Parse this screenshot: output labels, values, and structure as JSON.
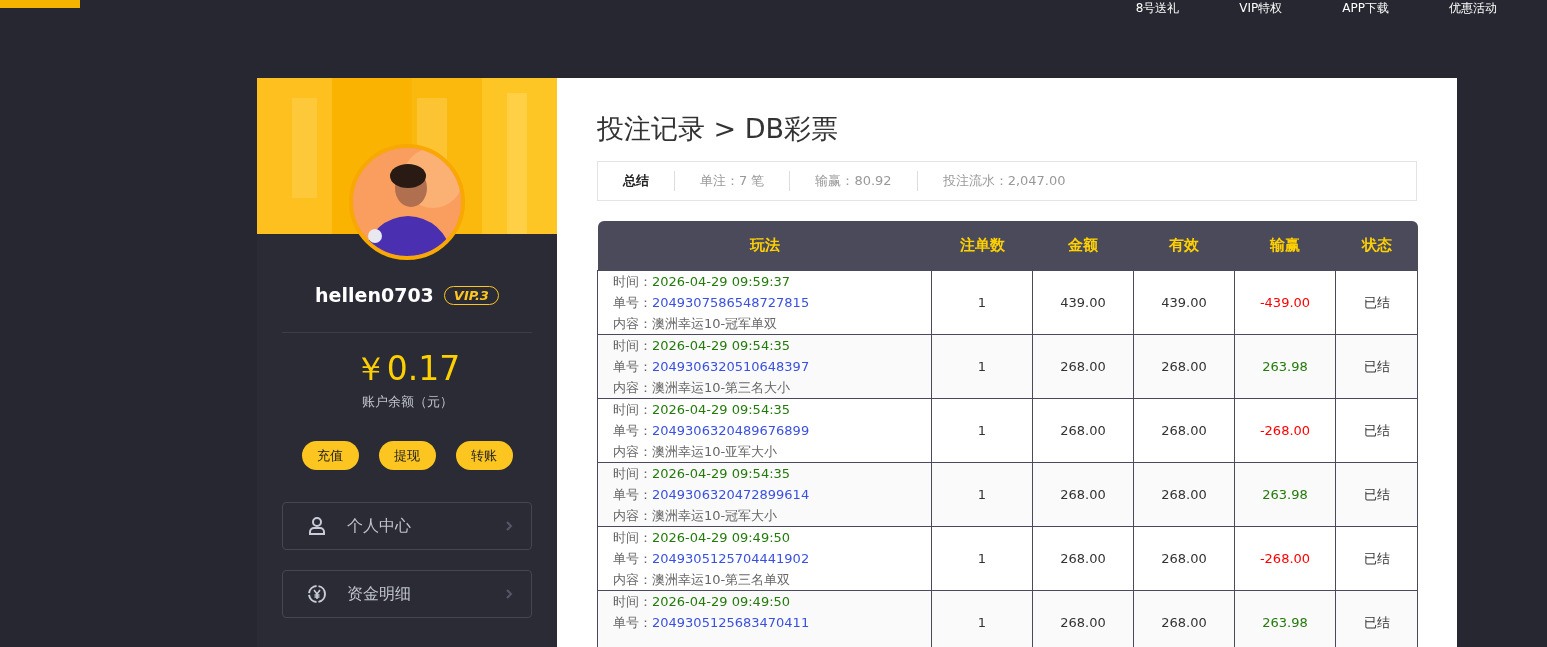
{
  "header": {
    "nav": [
      "8号送礼",
      "VIP特权",
      "APP下载",
      "优惠活动"
    ]
  },
  "profile": {
    "username": "hellen0703",
    "vip": "VIP.3",
    "balance": "￥0.17",
    "balance_label": "账户余额（元）",
    "actions": [
      "充值",
      "提现",
      "转账"
    ],
    "menu": [
      {
        "label": "个人中心"
      },
      {
        "label": "资金明细"
      }
    ]
  },
  "records": {
    "title": "投注记录 > DB彩票",
    "summary": [
      {
        "kind": "heading",
        "text": "总结"
      },
      {
        "kind": "stat",
        "text": "单注：7 笔"
      },
      {
        "kind": "stat",
        "text": "输赢：80.92"
      },
      {
        "kind": "stat",
        "text": "投注流水：2,047.00"
      }
    ],
    "table": {
      "columns": [
        "玩法",
        "注单数",
        "金额",
        "有效",
        "输赢",
        "状态"
      ],
      "rows": [
        {
          "time_label": "时间：",
          "time": "2026-04-29 09:59:37",
          "order_label": "单号：",
          "order": "2049307586548727815",
          "content_label": "内容：",
          "content": "澳洲幸运10-冠军单双",
          "count": "1",
          "amount": "439.00",
          "valid": "439.00",
          "profit": "-439.00",
          "color": "#ff0000",
          "status": "已结"
        },
        {
          "time_label": "时间：",
          "time": "2026-04-29 09:54:35",
          "order_label": "单号：",
          "order": "2049306320510648397",
          "content_label": "内容：",
          "content": "澳洲幸运10-第三名大小",
          "count": "1",
          "amount": "268.00",
          "valid": "268.00",
          "profit": "263.98",
          "color": "#237a0b",
          "status": "已结"
        },
        {
          "time_label": "时间：",
          "time": "2026-04-29 09:54:35",
          "order_label": "单号：",
          "order": "2049306320489676899",
          "content_label": "内容：",
          "content": "澳洲幸运10-亚军大小",
          "count": "1",
          "amount": "268.00",
          "valid": "268.00",
          "profit": "-268.00",
          "color": "#ff0000",
          "status": "已结"
        },
        {
          "time_label": "时间：",
          "time": "2026-04-29 09:54:35",
          "order_label": "单号：",
          "order": "2049306320472899614",
          "content_label": "内容：",
          "content": "澳洲幸运10-冠军大小",
          "count": "1",
          "amount": "268.00",
          "valid": "268.00",
          "profit": "263.98",
          "color": "#237a0b",
          "status": "已结"
        },
        {
          "time_label": "时间：",
          "time": "2026-04-29 09:49:50",
          "order_label": "单号：",
          "order": "2049305125704441902",
          "content_label": "内容：",
          "content": "澳洲幸运10-第三名单双",
          "count": "1",
          "amount": "268.00",
          "valid": "268.00",
          "profit": "-268.00",
          "color": "#ff0000",
          "status": "已结"
        },
        {
          "time_label": "时间：",
          "time": "2026-04-29 09:49:50",
          "order_label": "单号：",
          "order": "2049305125683470411",
          "count": "1",
          "amount": "268.00",
          "valid": "268.00",
          "profit": "263.98",
          "color": "#237a0b",
          "status": "已结"
        }
      ]
    }
  }
}
